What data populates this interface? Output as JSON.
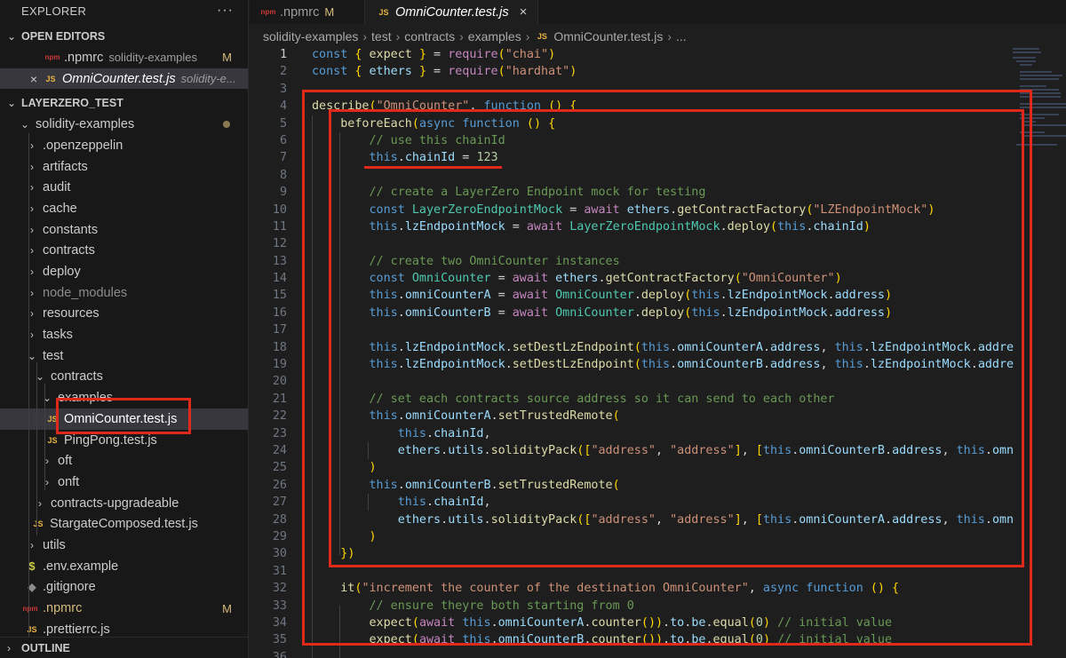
{
  "explorer": {
    "title": "EXPLORER",
    "more_icon": "more-dots-icon",
    "open_editors_label": "OPEN EDITORS",
    "open_editors": [
      {
        "icon": "npm-file-icon",
        "name": ".npmrc",
        "desc": "solidity-examples",
        "status": "M"
      },
      {
        "icon": "js-file-icon",
        "name": "OmniCounter.test.js",
        "desc": "solidity-e..."
      }
    ],
    "workspace_label": "LAYERZERO_TEST",
    "tree": [
      {
        "name": "solidity-examples",
        "chev": "⌄"
      },
      {
        "name": ".openzeppelin",
        "chev": "›"
      },
      {
        "name": "artifacts",
        "chev": "›"
      },
      {
        "name": "audit",
        "chev": "›"
      },
      {
        "name": "cache",
        "chev": "›"
      },
      {
        "name": "constants",
        "chev": "›"
      },
      {
        "name": "contracts",
        "chev": "›"
      },
      {
        "name": "deploy",
        "chev": "›"
      },
      {
        "name": "node_modules",
        "chev": "›"
      },
      {
        "name": "resources",
        "chev": "›"
      },
      {
        "name": "tasks",
        "chev": "›"
      },
      {
        "name": "test",
        "chev": "⌄"
      },
      {
        "name": "contracts",
        "chev": "⌄"
      },
      {
        "name": "examples",
        "chev": "⌄"
      },
      {
        "name": "OmniCounter.test.js"
      },
      {
        "name": "PingPong.test.js"
      },
      {
        "name": "oft",
        "chev": "›"
      },
      {
        "name": "onft",
        "chev": "›"
      },
      {
        "name": "contracts-upgradeable",
        "chev": "›"
      },
      {
        "name": "StargateComposed.test.js"
      },
      {
        "name": "utils",
        "chev": "›"
      },
      {
        "name": ".env.example",
        "icon_text": "$"
      },
      {
        "name": ".gitignore"
      },
      {
        "name": ".npmrc",
        "status": "M"
      },
      {
        "name": ".prettierrc.js"
      }
    ],
    "outline_label": "OUTLINE"
  },
  "tabs": [
    {
      "label": ".npmrc",
      "status": "M"
    },
    {
      "label": "OmniCounter.test.js",
      "close": "×"
    }
  ],
  "icons": {
    "js": "JS",
    "npm": "npm"
  },
  "breadcrumb": [
    "solidity-examples",
    "test",
    "contracts",
    "examples",
    "OmniCounter.test.js",
    "..."
  ],
  "editor": {
    "line_numbers": [
      "1",
      "2",
      "3",
      "4",
      "5",
      "6",
      "7",
      "8",
      "9",
      "10",
      "11",
      "12",
      "13",
      "14",
      "15",
      "16",
      "17",
      "18",
      "19",
      "20",
      "21",
      "22",
      "23",
      "24",
      "25",
      "26",
      "27",
      "28",
      "29",
      "30",
      "31",
      "32",
      "33",
      "34",
      "35",
      "36"
    ],
    "code_lines": [
      "const { expect } = require(\"chai\")",
      "const { ethers } = require(\"hardhat\")",
      "",
      "describe(\"OmniCounter\", function () {",
      "    beforeEach(async function () {",
      "        // use this chainId",
      "        this.chainId = 123",
      "",
      "        // create a LayerZero Endpoint mock for testing",
      "        const LayerZeroEndpointMock = await ethers.getContractFactory(\"LZEndpointMock\")",
      "        this.lzEndpointMock = await LayerZeroEndpointMock.deploy(this.chainId)",
      "",
      "        // create two OmniCounter instances",
      "        const OmniCounter = await ethers.getContractFactory(\"OmniCounter\")",
      "        this.omniCounterA = await OmniCounter.deploy(this.lzEndpointMock.address)",
      "        this.omniCounterB = await OmniCounter.deploy(this.lzEndpointMock.address)",
      "",
      "        this.lzEndpointMock.setDestLzEndpoint(this.omniCounterA.address, this.lzEndpointMock.address)",
      "        this.lzEndpointMock.setDestLzEndpoint(this.omniCounterB.address, this.lzEndpointMock.address)",
      "",
      "        // set each contracts source address so it can send to each other",
      "        this.omniCounterA.setTrustedRemote(",
      "            this.chainId,",
      "            ethers.utils.solidityPack([\"address\", \"address\"], [this.omniCounterB.address, this.omniCou",
      "        )",
      "        this.omniCounterB.setTrustedRemote(",
      "            this.chainId,",
      "            ethers.utils.solidityPack([\"address\", \"address\"], [this.omniCounterA.address, this.omniCou",
      "        )",
      "    })",
      "",
      "    it(\"increment the counter of the destination OmniCounter\", async function () {",
      "        // ensure theyre both starting from 0",
      "        expect(await this.omniCounterA.counter()).to.be.equal(0) // initial value",
      "        expect(await this.omniCounterB.counter()).to.be.equal(0) // initial value",
      ""
    ]
  },
  "colors": {
    "annotation": "#e0281b",
    "keyword": "#569cd6",
    "string": "#ce9178",
    "comment": "#6a9955"
  }
}
